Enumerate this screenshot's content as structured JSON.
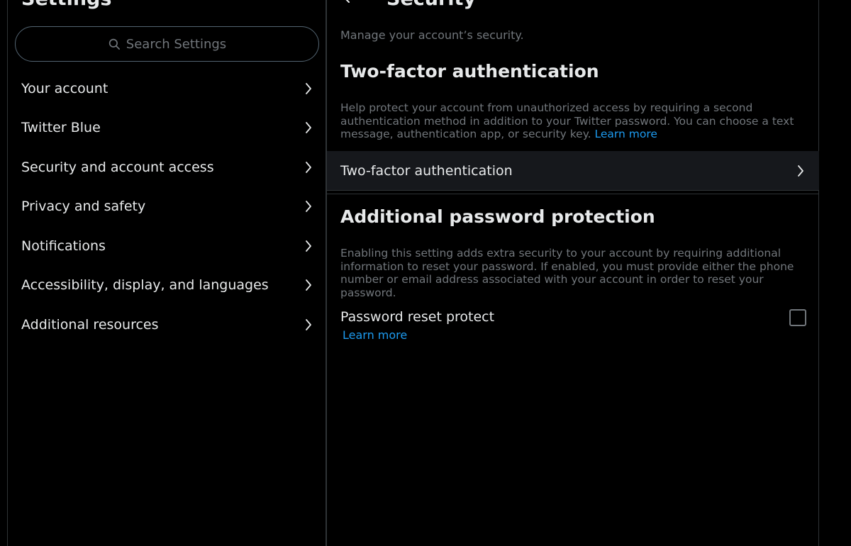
{
  "settings": {
    "title": "Settings",
    "search_placeholder": "Search Settings",
    "items": [
      {
        "label": "Your account"
      },
      {
        "label": "Twitter Blue"
      },
      {
        "label": "Security and account access"
      },
      {
        "label": "Privacy and safety"
      },
      {
        "label": "Notifications"
      },
      {
        "label": "Accessibility, display, and languages"
      },
      {
        "label": "Additional resources"
      }
    ]
  },
  "security": {
    "title": "Security",
    "subtitle": "Manage your account’s security.",
    "two_factor": {
      "heading": "Two-factor authentication",
      "description": "Help protect your account from unauthorized access by requiring a second authentication method in addition to your Twitter password. You can choose a text message, authentication app, or security key.",
      "learn_more": "Learn more",
      "row_label": "Two-factor authentication"
    },
    "password_protection": {
      "heading": "Additional password protection",
      "description": "Enabling this setting adds extra security to your account by requiring additional information to reset your password. If enabled, you must provide either the phone number or email address associated with your account in order to reset your password.",
      "option_label": "Password reset protect",
      "learn_more": "Learn more",
      "checked": false
    }
  },
  "icons": {
    "search": "search-icon",
    "chevron": "chevron-right-icon",
    "back": "arrow-left-icon"
  },
  "colors": {
    "background": "#000000",
    "text_primary": "#e7e9ea",
    "text_secondary": "#71767b",
    "link": "#1d9bf0",
    "border": "#2f3336",
    "row_highlight": "#16181c"
  }
}
